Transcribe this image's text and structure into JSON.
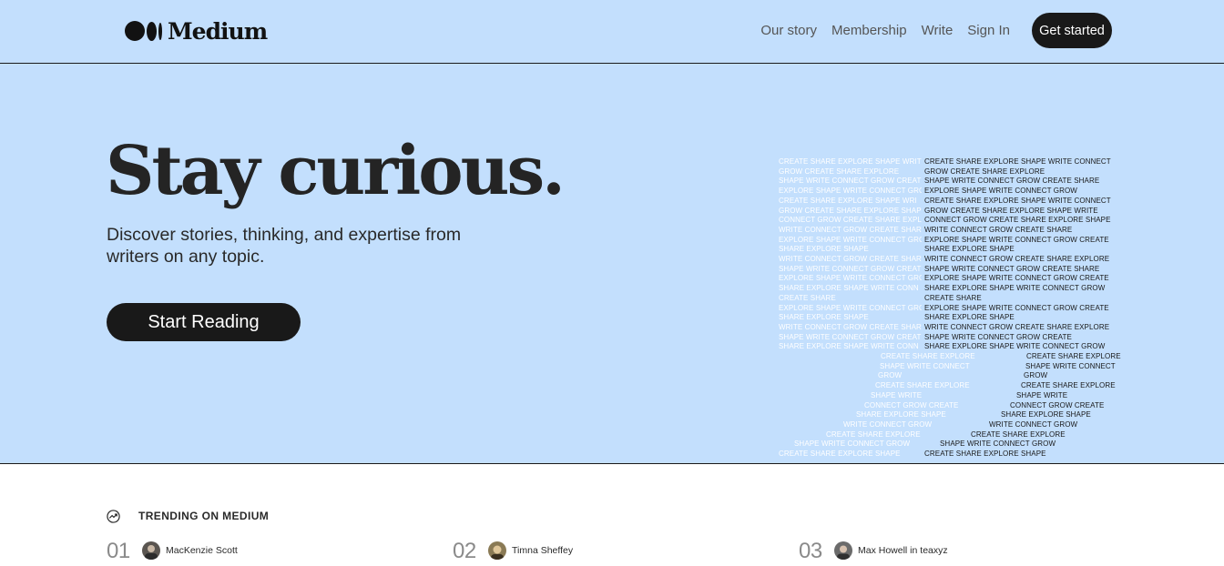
{
  "header": {
    "brand": "Medium",
    "nav": [
      "Our story",
      "Membership",
      "Write",
      "Sign In"
    ],
    "cta": "Get started",
    "background": "#c3dffd"
  },
  "hero": {
    "title": "Stay curious.",
    "subtitle": "Discover stories, thinking, and expertise from writers on any topic.",
    "cta": "Start Reading",
    "word_art": {
      "left_column": [
        "CREATE SHARE EXPLORE SHAPE WRITE",
        "GROW CREATE SHARE EXPLORE",
        "SHAPE WRITE CONNECT GROW CREATE",
        "EXPLORE SHAPE WRITE CONNECT GRO",
        "CREATE SHARE EXPLORE SHAPE WRI",
        "GROW CREATE SHARE EXPLORE SHAP",
        "CONNECT GROW CREATE SHARE EXPL",
        "WRITE CONNECT GROW CREATE SHAR",
        "EXPLORE SHAPE WRITE CONNECT GRO",
        "SHARE EXPLORE SHAPE",
        "WRITE CONNECT GROW CREATE SHARE",
        "SHAPE WRITE CONNECT GROW CREAT",
        "EXPLORE SHAPE WRITE CONNECT GRO",
        "SHARE EXPLORE SHAPE WRITE CONN",
        "CREATE SHARE",
        "EXPLORE SHAPE WRITE CONNECT GRO",
        "SHARE EXPLORE SHAPE",
        "WRITE CONNECT GROW CREATE SHAR",
        "SHAPE WRITE CONNECT GROW CREAT",
        "SHARE EXPLORE SHAPE WRITE CONN"
      ],
      "right_column": [
        "CREATE SHARE EXPLORE SHAPE WRITE CONNECT",
        "GROW CREATE SHARE EXPLORE",
        "SHAPE WRITE CONNECT GROW CREATE SHARE",
        "EXPLORE SHAPE WRITE CONNECT GROW",
        "CREATE SHARE EXPLORE SHAPE WRITE CONNECT",
        "GROW CREATE SHARE EXPLORE SHAPE WRITE",
        "CONNECT GROW CREATE SHARE EXPLORE SHAPE",
        "WRITE CONNECT GROW CREATE SHARE",
        "EXPLORE SHAPE WRITE CONNECT GROW CREATE",
        "SHARE EXPLORE SHAPE",
        "WRITE CONNECT GROW CREATE SHARE EXPLORE",
        "SHAPE WRITE CONNECT GROW CREATE SHARE",
        "EXPLORE SHAPE WRITE CONNECT GROW CREATE",
        "SHARE EXPLORE SHAPE WRITE CONNECT GROW",
        "CREATE SHARE",
        "EXPLORE SHAPE WRITE CONNECT GROW CREATE",
        "SHARE EXPLORE SHAPE",
        "WRITE CONNECT GROW CREATE SHARE EXPLORE",
        "SHAPE WRITE CONNECT GROW CREATE",
        "SHARE EXPLORE SHAPE WRITE CONNECT GROW"
      ],
      "leg_left": [
        "CREATE SHARE EXPLORE",
        "SHAPE WRITE CONNECT",
        "GROW",
        "CREATE SHARE EXPLORE",
        "SHAPE WRITE",
        "CONNECT GROW CREATE",
        "SHARE EXPLORE SHAPE",
        "WRITE CONNECT GROW",
        "CREATE SHARE EXPLORE",
        "SHAPE WRITE CONNECT GROW",
        "CREATE SHARE EXPLORE SHAPE"
      ],
      "leg_right": [
        "CREATE SHARE EXPLORE",
        "SHAPE WRITE CONNECT",
        "GROW",
        "CREATE SHARE EXPLORE",
        "SHAPE WRITE",
        "CONNECT GROW CREATE",
        "SHARE EXPLORE SHAPE",
        "WRITE CONNECT GROW",
        "CREATE SHARE EXPLORE",
        "SHAPE WRITE CONNECT GROW",
        "CREATE SHARE EXPLORE SHAPE"
      ]
    }
  },
  "trending": {
    "icon": "trending-icon",
    "label": "TRENDING ON MEDIUM",
    "items": [
      {
        "number": "01",
        "author": "MacKenzie Scott"
      },
      {
        "number": "02",
        "author": "Timna Sheffey"
      },
      {
        "number": "03",
        "author": "Max Howell in teaxyz"
      }
    ]
  }
}
